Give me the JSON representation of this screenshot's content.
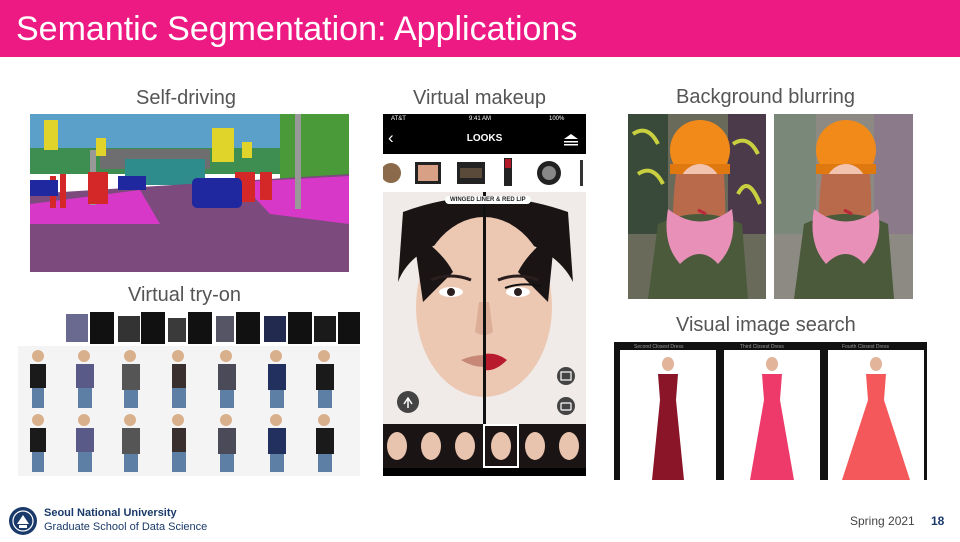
{
  "slide": {
    "title": "Semantic Segmentation: Applications",
    "sections": {
      "self_driving": "Self-driving",
      "virtual_tryon": "Virtual try-on",
      "virtual_makeup": "Virtual makeup",
      "background_blurring": "Background blurring",
      "visual_search": "Visual image search"
    }
  },
  "phone": {
    "carrier": "AT&T",
    "time": "9:41 AM",
    "battery": "100%",
    "screen_title": "LOOKS",
    "look_name": "WINGED LINER & RED LIP"
  },
  "search_results": {
    "captions": [
      "Second Closest Dress",
      "Third Closest Dress",
      "Fourth Closest Dress"
    ]
  },
  "footer": {
    "university": "Seoul National University",
    "school": "Graduate School of Data Science",
    "term": "Spring 2021",
    "page_number": "18"
  },
  "colors": {
    "accent": "#ee1a84",
    "text_gray": "#555555",
    "brand_navy": "#1a3a6b"
  }
}
